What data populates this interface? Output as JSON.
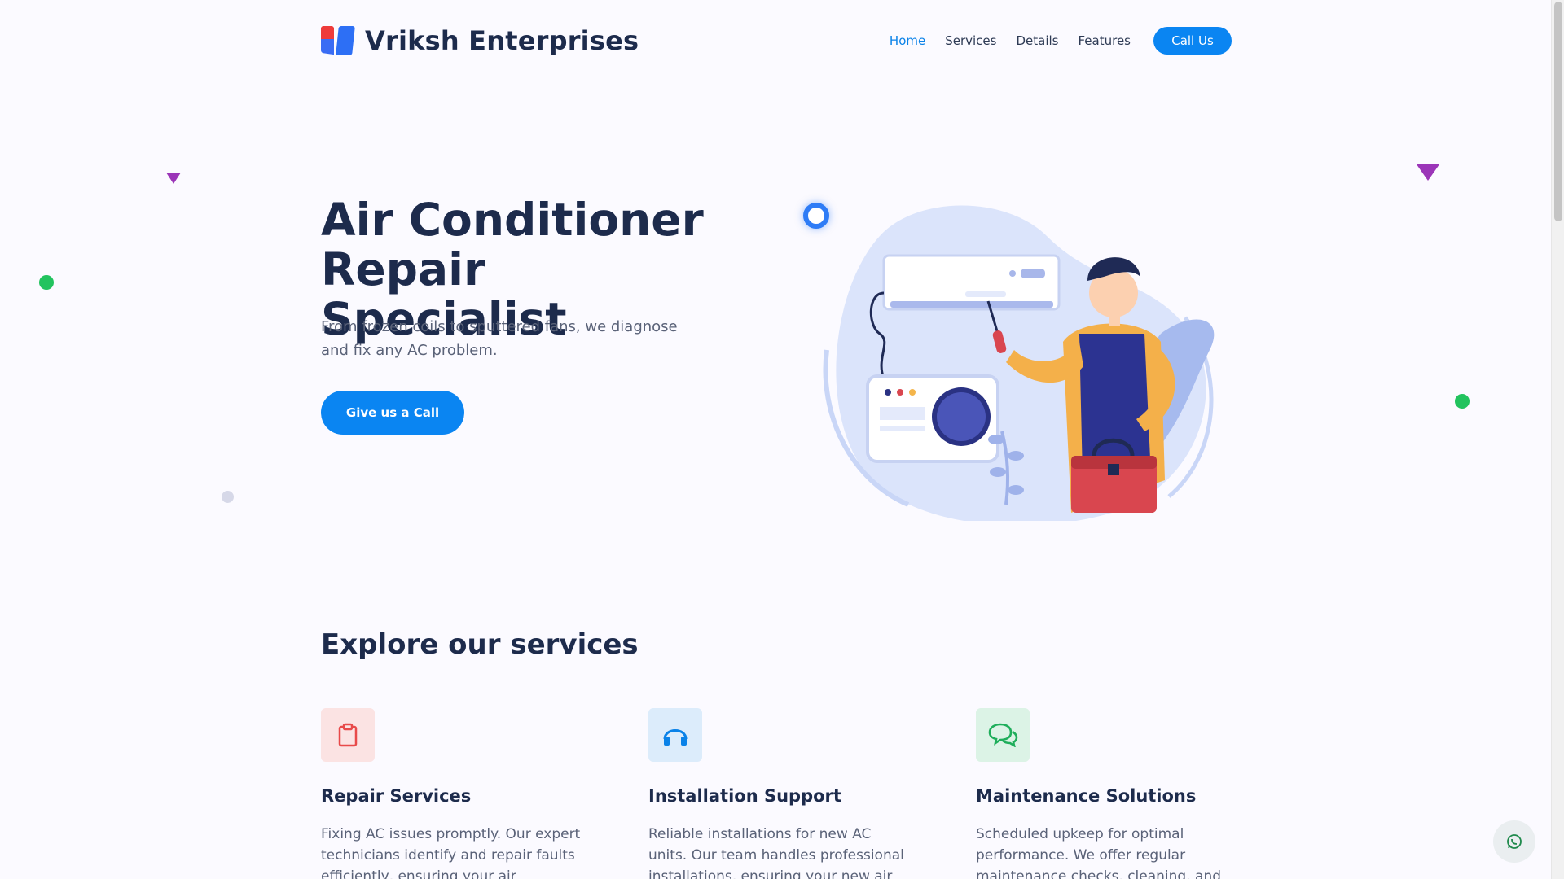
{
  "header": {
    "brand": "Vriksh Enterprises",
    "nav": [
      {
        "label": "Home",
        "active": true
      },
      {
        "label": "Services",
        "active": false
      },
      {
        "label": "Details",
        "active": false
      },
      {
        "label": "Features",
        "active": false
      }
    ],
    "cta": "Call Us"
  },
  "hero": {
    "title_line1": "Air Conditioner",
    "title_line2": "Repair Specialist",
    "subtitle": "From frozen coils to sputtered fans, we diagnose and fix any AC problem.",
    "button": "Give us a Call"
  },
  "services": {
    "title": "Explore our services",
    "items": [
      {
        "title": "Repair Services",
        "text": "Fixing AC issues promptly. Our expert technicians identify and repair faults efficiently, ensuring your air conditioner",
        "icon": "clipboard-icon",
        "color": "#e84a4a",
        "bg": "#fbe3e3"
      },
      {
        "title": "Installation Support",
        "text": "Reliable installations for new AC units. Our team handles professional installations, ensuring your new air",
        "icon": "headphones-icon",
        "color": "#0a82e8",
        "bg": "#dcecfb"
      },
      {
        "title": "Maintenance Solutions",
        "text": "Scheduled upkeep for optimal performance. We offer regular maintenance checks, cleaning, and tune-",
        "icon": "chat-bubbles-icon",
        "color": "#1fae5b",
        "bg": "#dcf3e6"
      }
    ]
  },
  "colors": {
    "accent": "#0a85f2",
    "heading": "#1d2b4c",
    "body_text": "#5a6278",
    "background": "#fbfaff"
  }
}
